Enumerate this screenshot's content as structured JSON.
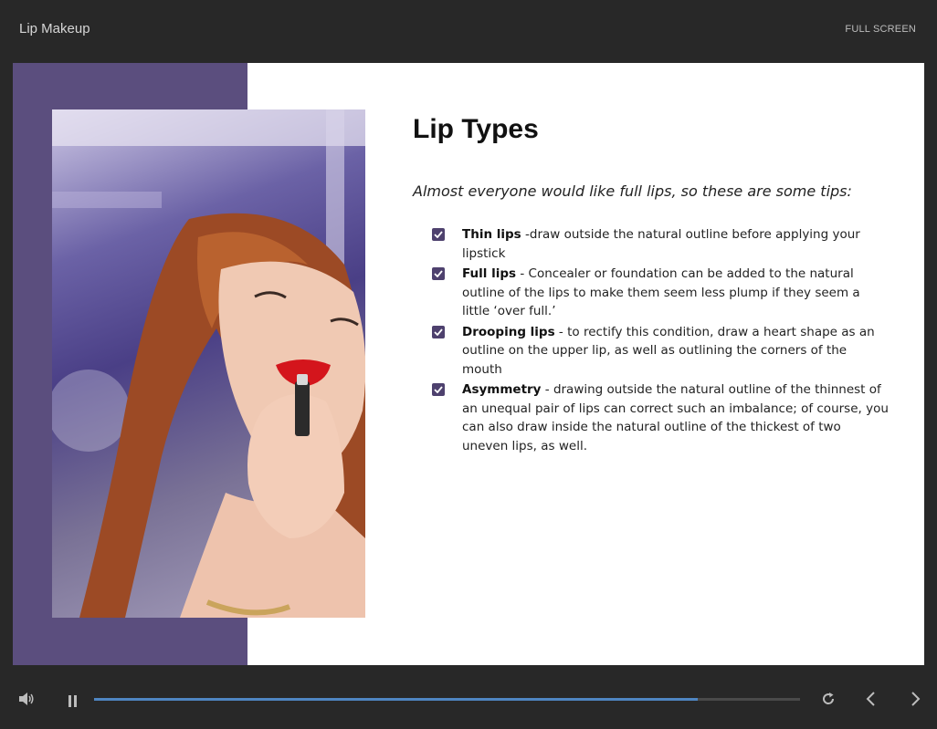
{
  "window": {
    "title": "Lip Makeup",
    "fullscreen_label": "FULL SCREEN"
  },
  "slide": {
    "title": "Lip Types",
    "intro": "Almost everyone would like full lips, so these are some tips:",
    "tips": [
      {
        "bold": "Thin lips",
        "text": " -draw outside the natural outline before applying your lipstick"
      },
      {
        "bold": "Full lips",
        "text": " - Concealer or foundation can be added to the natural outline of the lips to make them seem less plump if they seem a little ‘over full.’"
      },
      {
        "bold": "Drooping lips",
        "text": " - to rectify this condition, draw a heart shape as an outline on the upper lip, as well as outlining the corners of the mouth"
      },
      {
        "bold": "Asymmetry",
        "text": " - drawing outside the natural outline of the thinnest of an unequal pair of lips can correct such an imbalance; of course, you can also draw inside the natural outline of the thickest of two uneven lips, as well."
      }
    ],
    "photo_icon": "woman-applying-lipstick-photo"
  },
  "player": {
    "progress": 0.855,
    "icons": {
      "volume": "speaker-icon",
      "pause": "pause-icon",
      "replay": "replay-icon",
      "prev": "chevron-left-icon",
      "next": "chevron-right-icon"
    }
  },
  "colors": {
    "accent_purple": "#5b4e7e",
    "checkbox": "#4e416e",
    "progress": "#4f86c2",
    "chrome_bg": "#282828"
  }
}
